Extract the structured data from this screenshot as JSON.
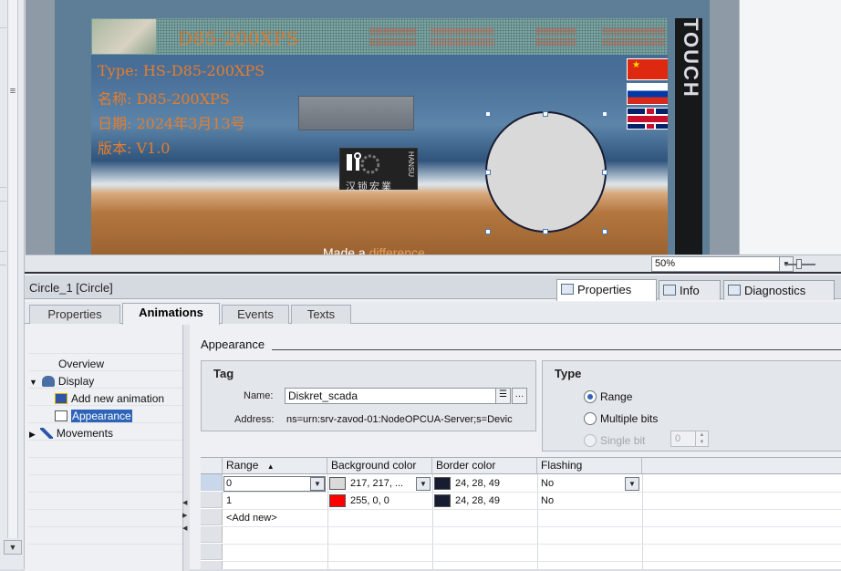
{
  "hmi": {
    "model_title": "D85-200XPS",
    "info_lines": [
      "Type: HS-D85-200XPS",
      "名称: D85-200XPS",
      "日期: 2024年3月13号",
      "版本: V1.0"
    ],
    "brand_text": "汉锁宏業",
    "brand_side": "HANSU",
    "tagline_start": "Made a ",
    "tagline_highlight": "difference",
    "touch_text": "TOUCH",
    "flag_cn_star": "★",
    "colors": {
      "info_text": "#e67d2c",
      "circle_fill": "#d9d9d9",
      "circle_border": "#181c31"
    }
  },
  "zoom": {
    "value": "50%"
  },
  "inspector": {
    "title": "Circle_1 [Circle]",
    "tabs": [
      {
        "label": "Properties",
        "icon": "properties-icon",
        "active": true
      },
      {
        "label": "Info",
        "icon": "info-icon",
        "active": false
      },
      {
        "label": "Diagnostics",
        "icon": "diagnostics-icon",
        "active": false
      }
    ],
    "subtabs": [
      "Properties",
      "Animations",
      "Events",
      "Texts"
    ],
    "active_subtab": "Animations"
  },
  "tree": {
    "overview": "Overview",
    "display": "Display",
    "add_new_animation": "Add new animation",
    "appearance": "Appearance",
    "movements": "Movements"
  },
  "appearance": {
    "section_title": "Appearance",
    "tag": {
      "title": "Tag",
      "name_label": "Name:",
      "name_value": "Diskret_scada",
      "address_label": "Address:",
      "address_value": "ns=urn:srv-zavod-01:NodeOPCUA-Server;s=Devic"
    },
    "type": {
      "title": "Type",
      "options": [
        "Range",
        "Multiple bits",
        "Single bit"
      ],
      "selected": "Range",
      "single_bit_value": "0"
    },
    "table": {
      "headers": [
        "Range",
        "Background color",
        "Border color",
        "Flashing"
      ],
      "sort_indicator": "▲",
      "rows": [
        {
          "range": "0",
          "bg_color": "217, 217, ...",
          "bg_hex": "#d9d9d9",
          "border_color": "24, 28, 49",
          "border_hex": "#181c31",
          "flashing": "No"
        },
        {
          "range": "1",
          "bg_color": "255, 0, 0",
          "bg_hex": "#ff0000",
          "border_color": "24, 28, 49",
          "border_hex": "#181c31",
          "flashing": "No"
        }
      ],
      "add_new": "<Add new>"
    }
  }
}
